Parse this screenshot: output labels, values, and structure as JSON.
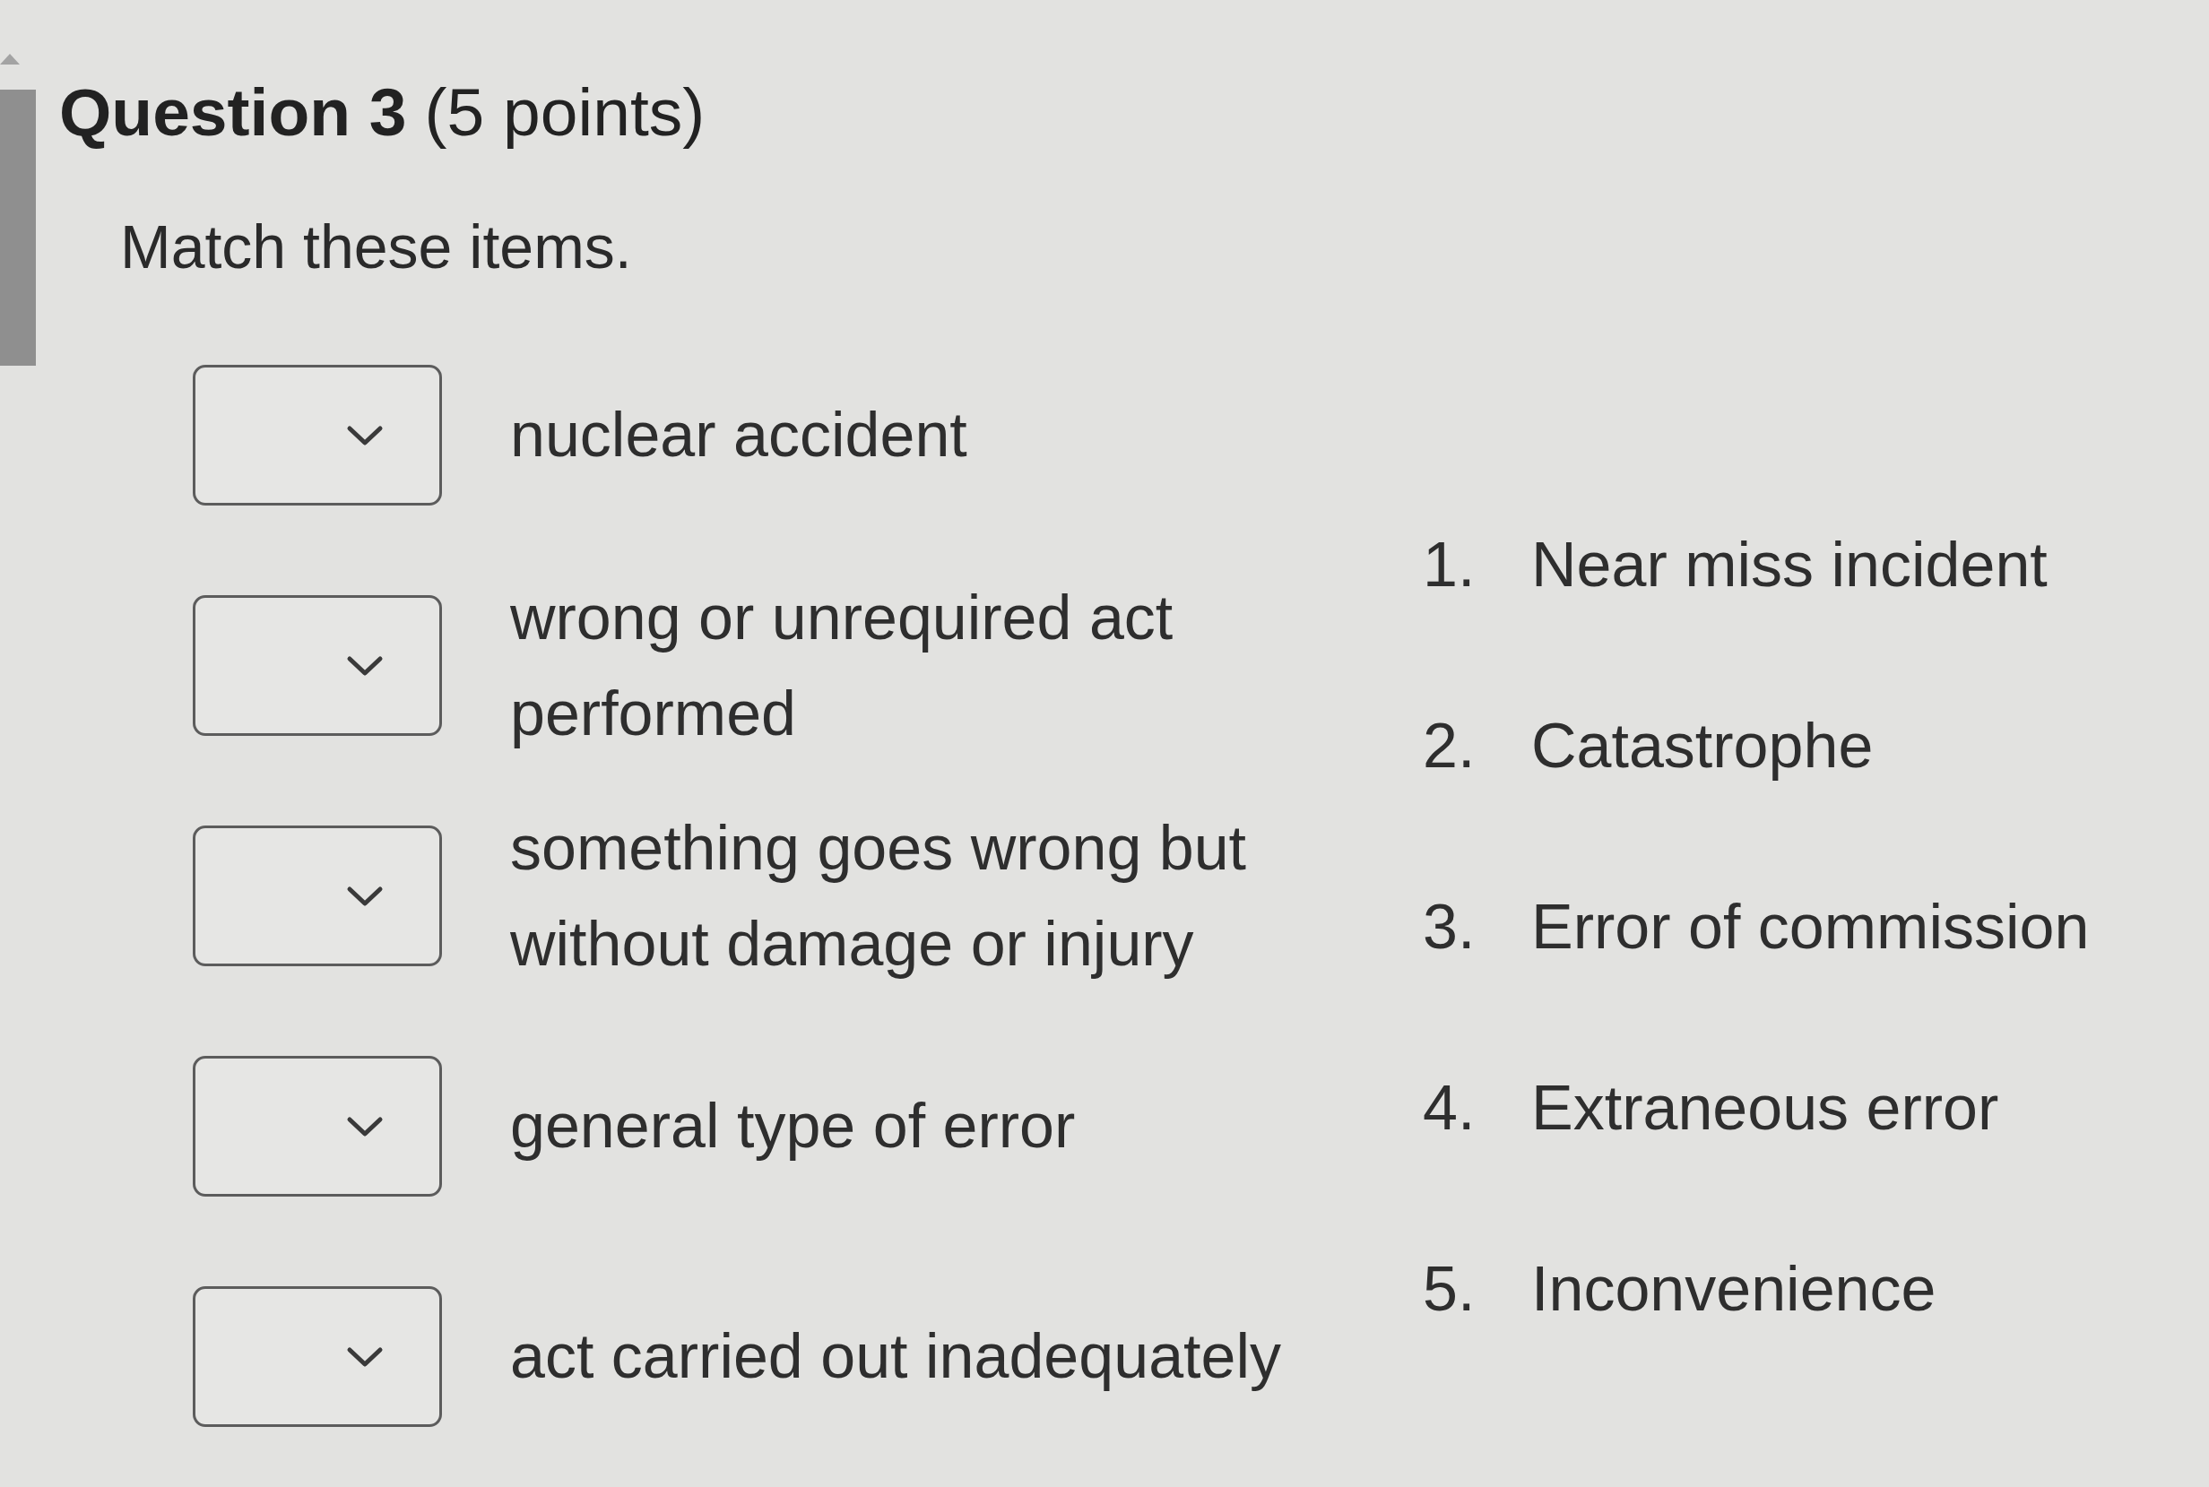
{
  "question": {
    "title": "Question 3",
    "points": "(5 points)"
  },
  "instruction": "Match these items.",
  "prompts": [
    {
      "text": "nuclear accident"
    },
    {
      "text": "wrong or unrequired act performed"
    },
    {
      "text": "something goes wrong but without damage or injury"
    },
    {
      "text": "general type of error"
    },
    {
      "text": "act carried out inadequately"
    }
  ],
  "answers": [
    {
      "number": "1.",
      "label": "Near miss incident"
    },
    {
      "number": "2.",
      "label": "Catastrophe"
    },
    {
      "number": "3.",
      "label": "Error of commission"
    },
    {
      "number": "4.",
      "label": "Extraneous error"
    },
    {
      "number": "5.",
      "label": "Inconvenience"
    }
  ]
}
